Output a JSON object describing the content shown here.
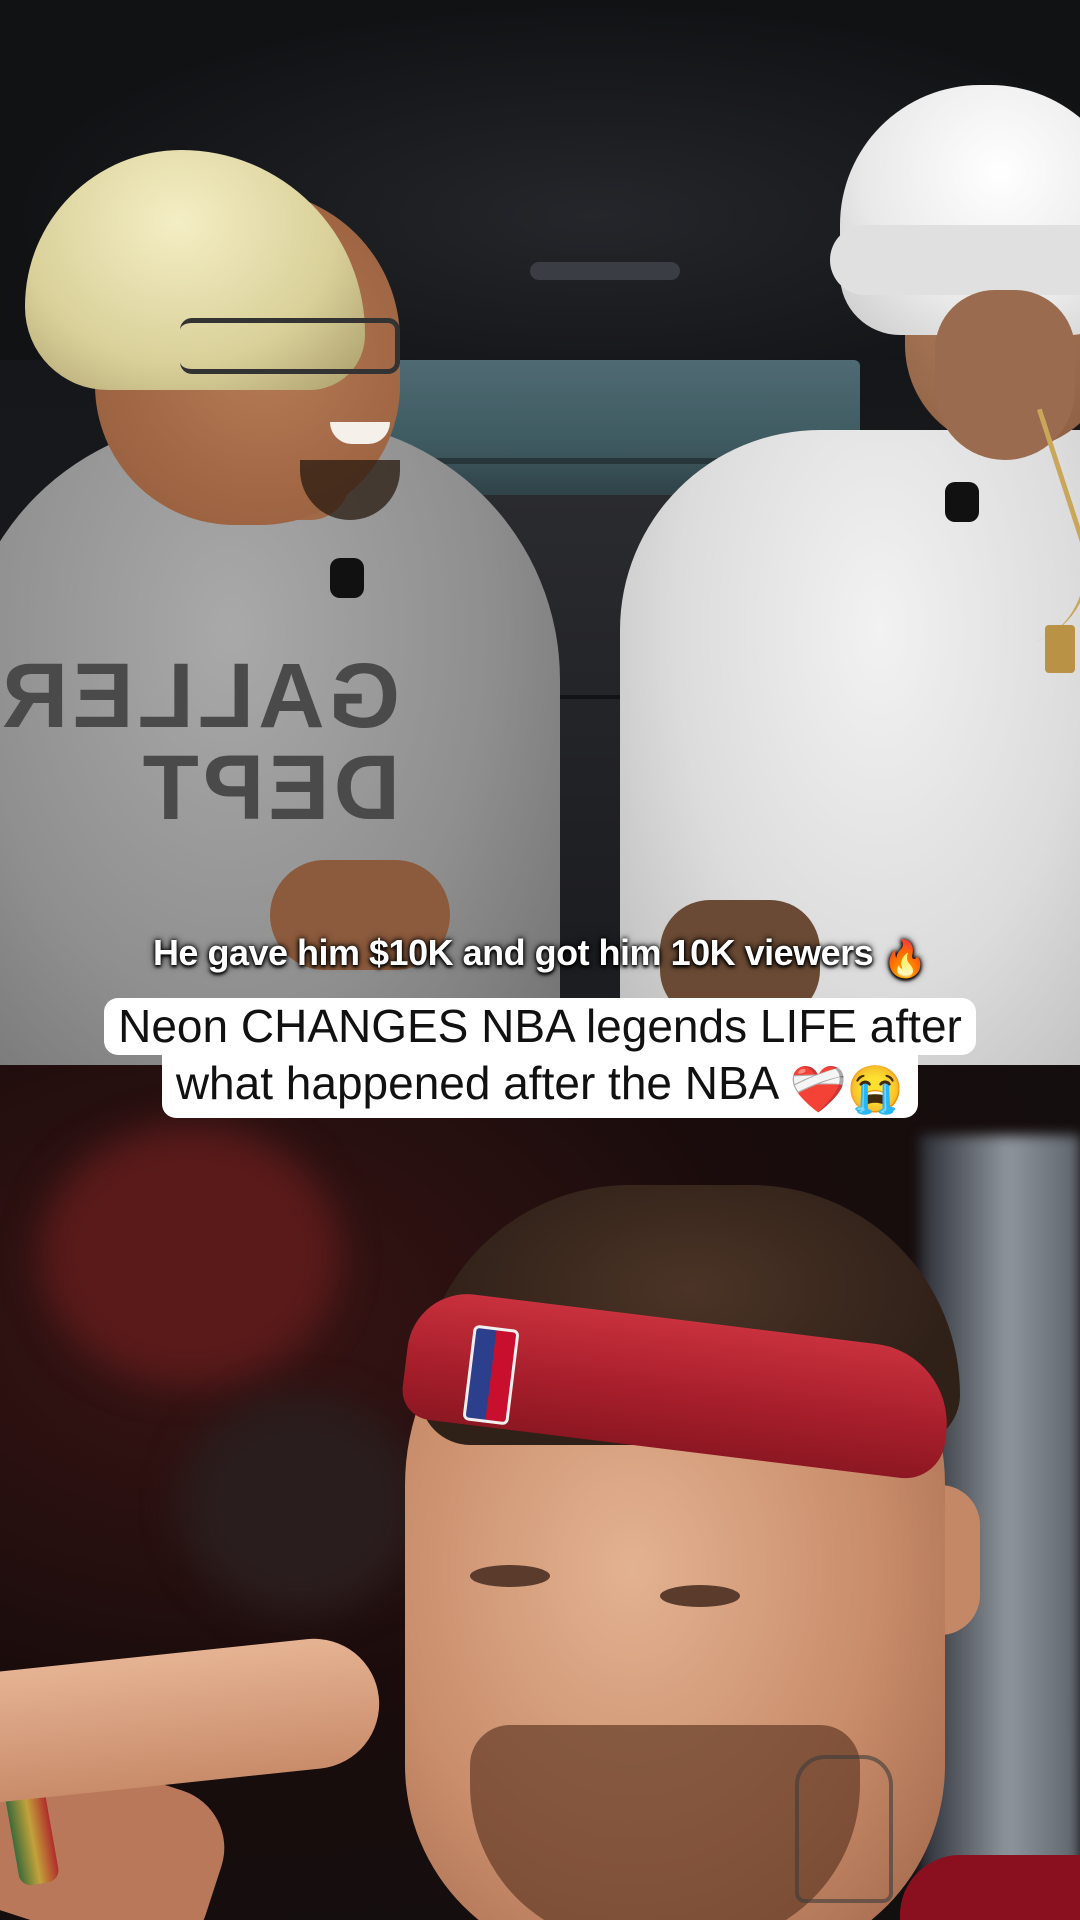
{
  "video": {
    "top_clip": "car-interview",
    "bottom_clip": "nba-player-closeup"
  },
  "subtitle": {
    "text": "He gave him $10K and got him 10K viewers",
    "emoji": "🔥"
  },
  "caption": {
    "line1": "Neon CHANGES NBA legends LIFE after",
    "line2_text": "what happened after the NBA",
    "line2_emoji": "❤️‍🩹😭"
  },
  "colors": {
    "caption_bg": "#ffffff",
    "caption_text": "#111111",
    "subtitle_text": "#ffffff",
    "headband": "#b8242f"
  }
}
